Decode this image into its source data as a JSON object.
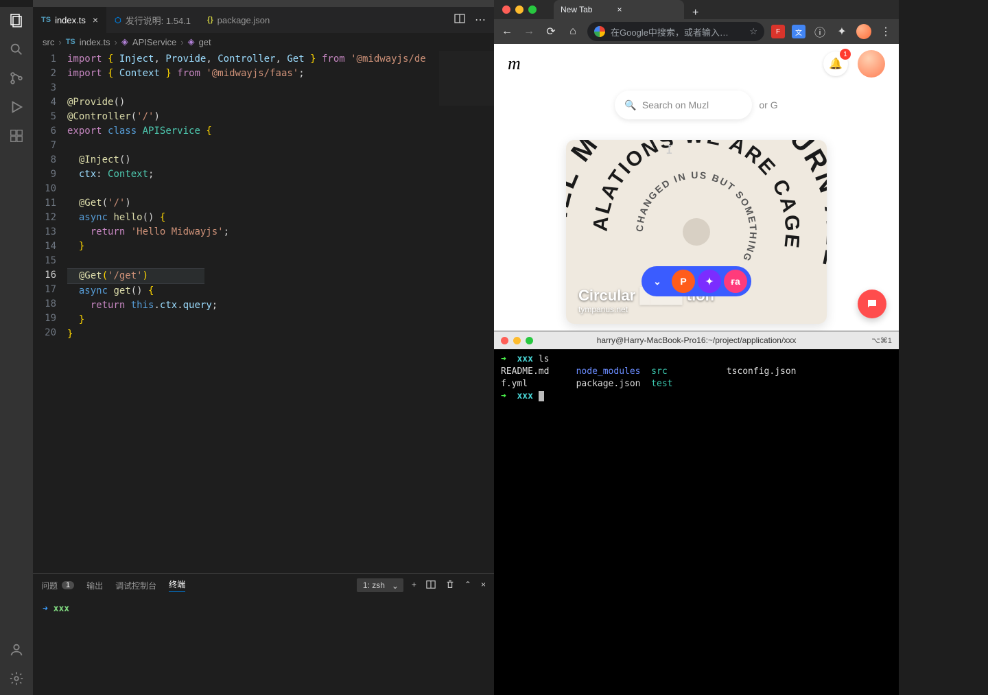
{
  "vscode": {
    "tabs": [
      {
        "icon": "TS",
        "label": "index.ts",
        "active": true,
        "closable": true
      },
      {
        "icon": "⬡",
        "label": "发行说明: 1.54.1",
        "active": false
      },
      {
        "icon": "{}",
        "label": "package.json",
        "active": false
      }
    ],
    "breadcrumbs": [
      "src",
      "index.ts",
      "APIService",
      "get"
    ],
    "code": {
      "lines": [
        "import { Inject, Provide, Controller, Get } from '@midwayjs/de",
        "import { Context } from '@midwayjs/faas';",
        "",
        "@Provide()",
        "@Controller('/')",
        "export class APIService {",
        "",
        "  @Inject()",
        "  ctx: Context;",
        "",
        "  @Get('/')",
        "  async hello() {",
        "    return 'Hello Midwayjs';",
        "  }",
        "",
        "  @Get('/get')",
        "  async get() {",
        "    return this.ctx.query;",
        "  }",
        "}"
      ],
      "active_line": 16
    },
    "panel": {
      "tabs": [
        "问题",
        "输出",
        "调试控制台",
        "终端"
      ],
      "problems_badge": "1",
      "active": "终端",
      "terminal_selector": "1: zsh",
      "body_prompt": "xxx"
    }
  },
  "browser": {
    "tab_label": "New Tab",
    "omnibox_placeholder": "在Google中搜索，或者输入…",
    "muz": {
      "logo": "m",
      "bell_badge": "1",
      "search_placeholder": "Search on Muzl",
      "or_text": "or G",
      "hero_title": "Circular",
      "hero_title_suffix": "tion",
      "hero_sub": "tympanus.net",
      "spiral_text_outer": "ALL MY THE LIES BURN ALL",
      "spiral_text_mid": "ALATIONS WE ARE CAGE",
      "spiral_text_inner": "CHANGED IN US BUT SOMETHING",
      "pill_p": "P"
    }
  },
  "terminal": {
    "title": "harry@Harry-MacBook-Pro16:~/project/application/xxx",
    "shortcut": "⌥⌘1",
    "lines": {
      "l1_prompt": "xxx",
      "l1_cmd": "ls",
      "ls": {
        "c1a": "README.md",
        "c1b": "f.yml",
        "c2a": "node_modules",
        "c2b": "package.json",
        "c3a": "src",
        "c3b": "test",
        "c4a": "tsconfig.json"
      },
      "l2_prompt": "xxx"
    }
  }
}
